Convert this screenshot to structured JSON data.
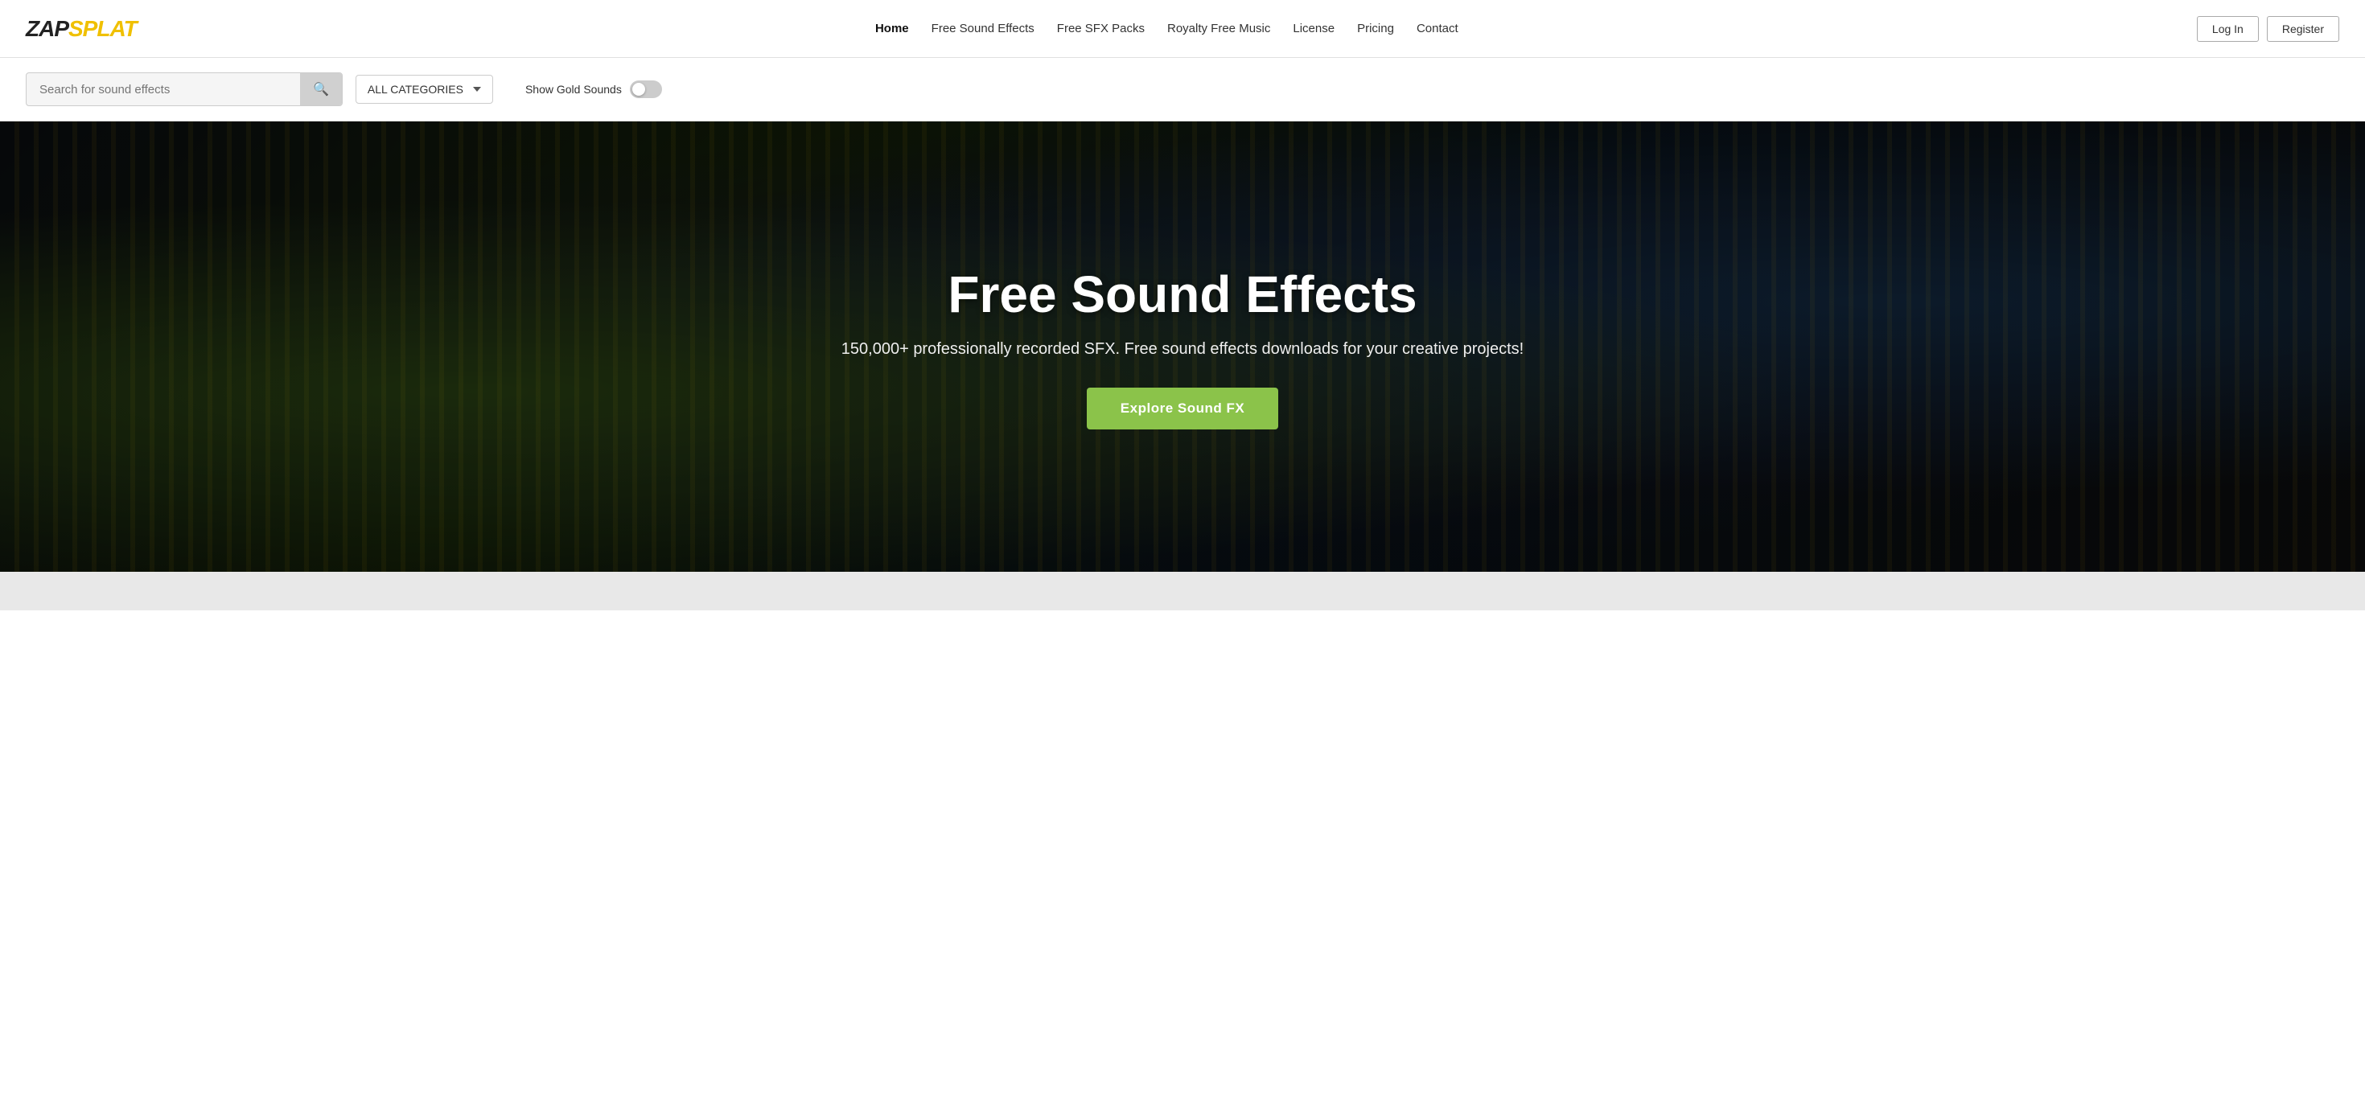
{
  "header": {
    "logo": "ZAPSPLAT",
    "logo_zap": "ZAP",
    "logo_splat": "SPLAT",
    "nav": {
      "items": [
        {
          "label": "Home",
          "active": true
        },
        {
          "label": "Free Sound Effects",
          "active": false
        },
        {
          "label": "Free SFX Packs",
          "active": false
        },
        {
          "label": "Royalty Free Music",
          "active": false
        },
        {
          "label": "License",
          "active": false
        },
        {
          "label": "Pricing",
          "active": false
        },
        {
          "label": "Contact",
          "active": false
        }
      ],
      "login_label": "Log In",
      "register_label": "Register"
    }
  },
  "search": {
    "placeholder": "Search for sound effects",
    "category_label": "ALL CATEGORIES",
    "gold_label": "Show Gold Sounds"
  },
  "hero": {
    "title": "Free Sound Effects",
    "subtitle": "150,000+ professionally recorded SFX. Free sound effects downloads for your creative projects!",
    "cta_label": "Explore Sound FX"
  }
}
